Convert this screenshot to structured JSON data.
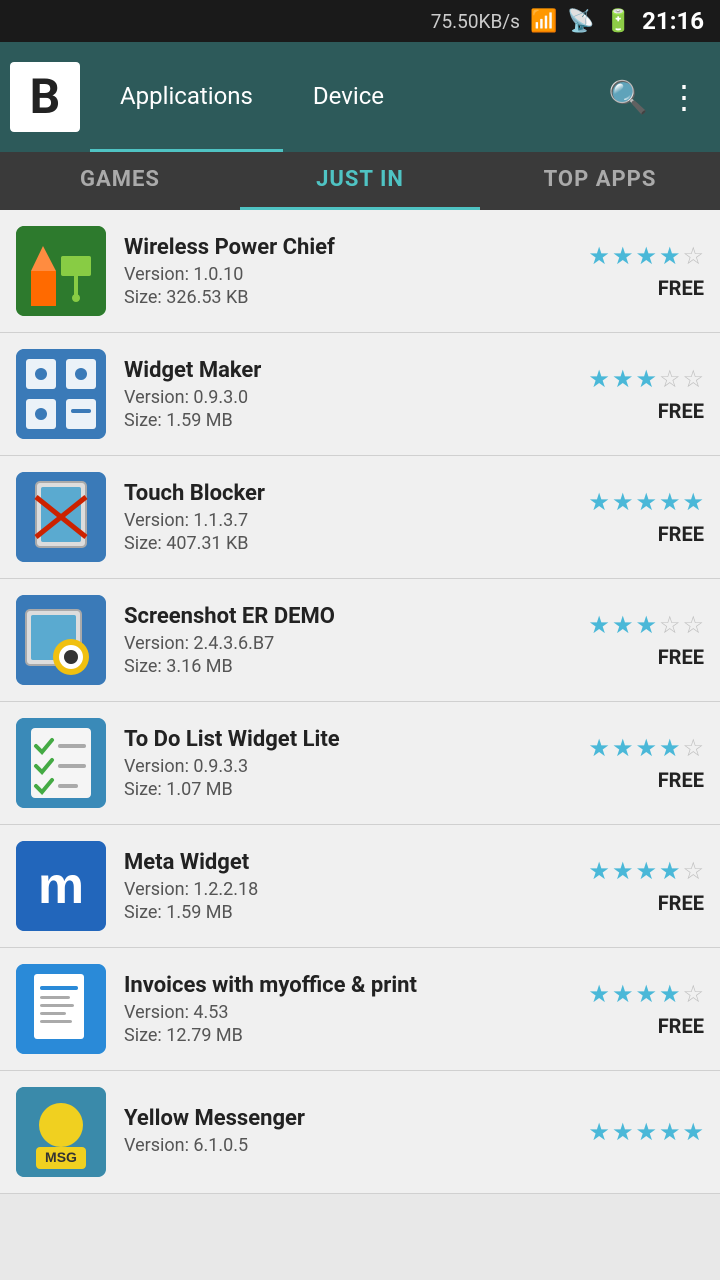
{
  "statusBar": {
    "network": "75.50KB/s",
    "time": "21:16",
    "wifiIcon": "wifi",
    "signalIcon": "signal"
  },
  "header": {
    "logoLetter": "B",
    "navItems": [
      {
        "label": "Applications",
        "active": true
      },
      {
        "label": "Device",
        "active": false
      }
    ],
    "searchIcon": "🔍",
    "menuIcon": "⋮"
  },
  "tabs": [
    {
      "label": "GAMES",
      "active": false
    },
    {
      "label": "JUST IN",
      "active": true
    },
    {
      "label": "TOP APPS",
      "active": false
    }
  ],
  "apps": [
    {
      "name": "Wireless Power Chief",
      "version": "Version: 1.0.10",
      "size": "Size: 326.53 KB",
      "stars": 4,
      "maxStars": 5,
      "price": "FREE",
      "iconClass": "icon-wireless"
    },
    {
      "name": "Widget Maker",
      "version": "Version: 0.9.3.0",
      "size": "Size: 1.59 MB",
      "stars": 3,
      "maxStars": 5,
      "price": "FREE",
      "iconClass": "icon-widget-maker"
    },
    {
      "name": "Touch Blocker",
      "version": "Version: 1.1.3.7",
      "size": "Size: 407.31 KB",
      "stars": 5,
      "maxStars": 5,
      "price": "FREE",
      "iconClass": "icon-touch-blocker"
    },
    {
      "name": "Screenshot ER DEMO",
      "version": "Version: 2.4.3.6.B7",
      "size": "Size: 3.16 MB",
      "stars": 3,
      "maxStars": 5,
      "price": "FREE",
      "iconClass": "icon-screenshot"
    },
    {
      "name": "To Do List Widget Lite",
      "version": "Version: 0.9.3.3",
      "size": "Size: 1.07 MB",
      "stars": 4,
      "maxStars": 5,
      "price": "FREE",
      "iconClass": "icon-todo"
    },
    {
      "name": "Meta Widget",
      "version": "Version: 1.2.2.18",
      "size": "Size: 1.59 MB",
      "stars": 4,
      "maxStars": 5,
      "price": "FREE",
      "iconClass": "icon-meta"
    },
    {
      "name": "Invoices with myoffice & print",
      "version": "Version: 4.53",
      "size": "Size: 12.79 MB",
      "stars": 4,
      "maxStars": 5,
      "price": "FREE",
      "iconClass": "icon-invoices"
    },
    {
      "name": "Yellow Messenger",
      "version": "Version: 6.1.0.5",
      "size": "",
      "stars": 5,
      "maxStars": 5,
      "price": "",
      "iconClass": "icon-yellow"
    }
  ]
}
